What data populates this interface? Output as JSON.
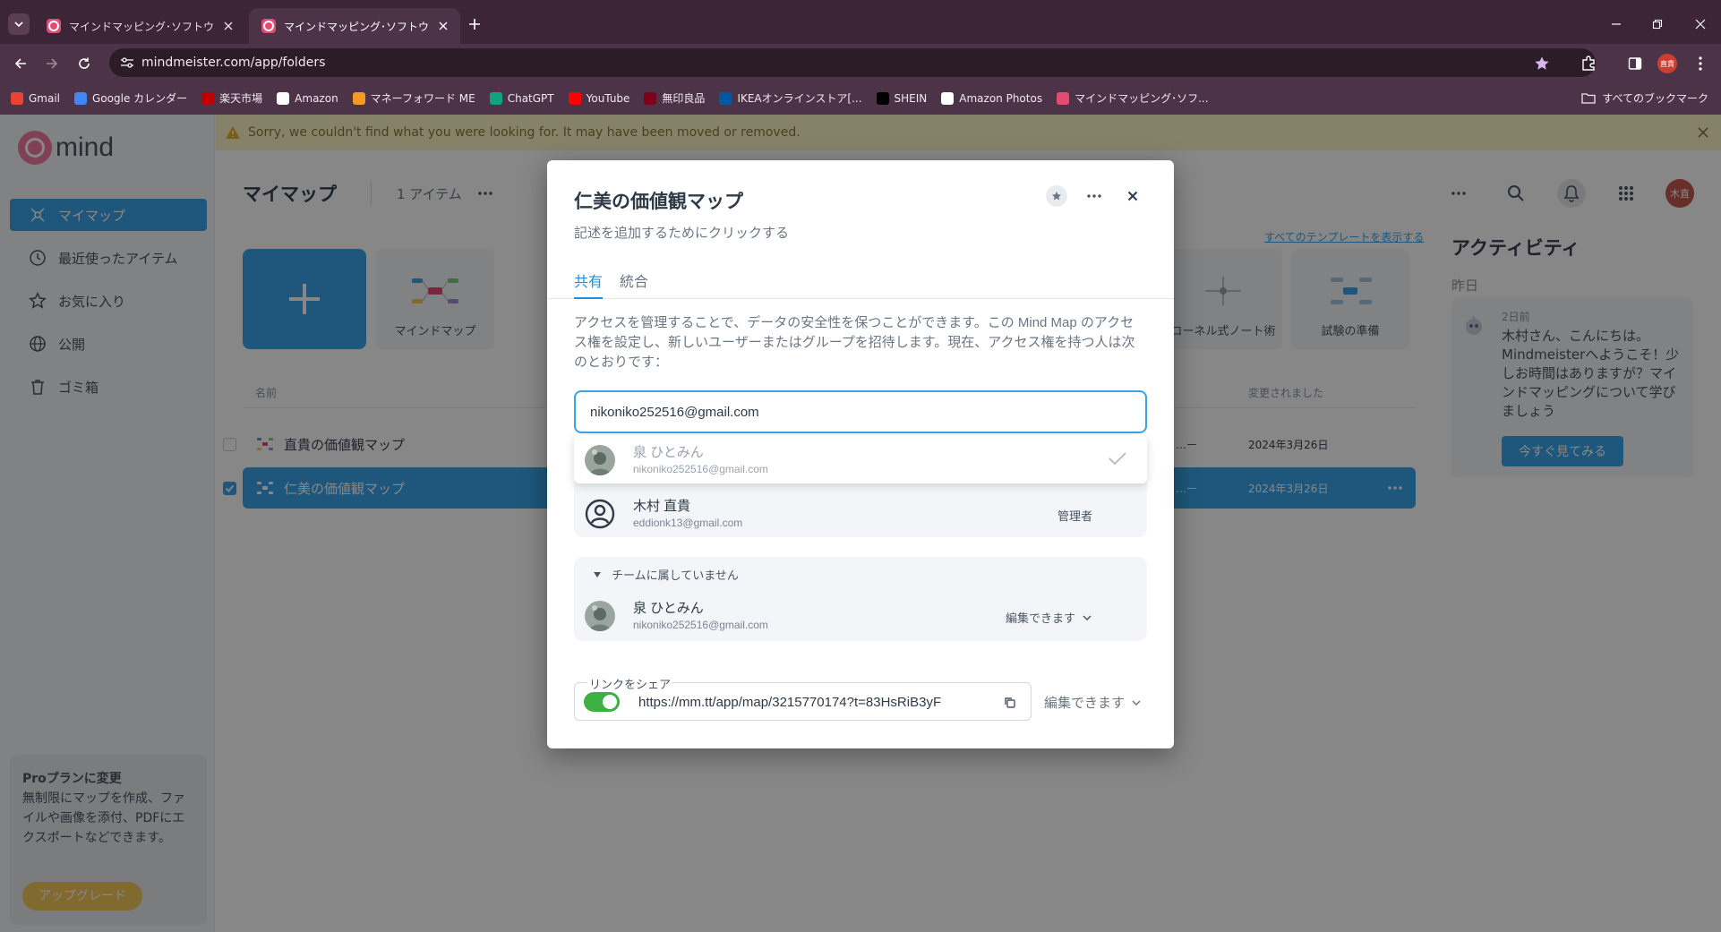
{
  "browser": {
    "tabs": [
      {
        "title": "マインドマッピング･ソフトウェア - オン",
        "active": false
      },
      {
        "title": "マインドマッピング･ソフトウェア - オン",
        "active": true
      }
    ],
    "url": "mindmeister.com/app/folders",
    "profile_initial": "直貴",
    "bookmarks": [
      {
        "label": "Gmail",
        "icon": "gmail-icon",
        "color": "#ea4335"
      },
      {
        "label": "Google カレンダー",
        "icon": "calendar-icon",
        "color": "#4285f4"
      },
      {
        "label": "楽天市場",
        "icon": "rakuten-icon",
        "color": "#bf0000"
      },
      {
        "label": "Amazon",
        "icon": "amazon-icon",
        "color": "#ffffff"
      },
      {
        "label": "マネーフォワード ME",
        "icon": "moneyforward-icon",
        "color": "#f59a23"
      },
      {
        "label": "ChatGPT",
        "icon": "chatgpt-icon",
        "color": "#10a37f"
      },
      {
        "label": "YouTube",
        "icon": "youtube-icon",
        "color": "#ff0000"
      },
      {
        "label": "無印良品",
        "icon": "muji-icon",
        "color": "#7f0019"
      },
      {
        "label": "IKEAオンラインストア[...",
        "icon": "ikea-icon",
        "color": "#0058a3"
      },
      {
        "label": "SHEIN",
        "icon": "shein-icon",
        "color": "#000000"
      },
      {
        "label": "Amazon Photos",
        "icon": "amazon-icon",
        "color": "#ffffff"
      },
      {
        "label": "マインドマッピング･ソフ...",
        "icon": "mindmeister-icon",
        "color": "#e34c72"
      }
    ],
    "all_bookmarks": "すべてのブックマーク"
  },
  "app": {
    "logo_text": "mind",
    "nav": [
      {
        "label": "マイマップ",
        "icon": "mindmap-icon",
        "active": true
      },
      {
        "label": "最近使ったアイテム",
        "icon": "clock-icon",
        "active": false
      },
      {
        "label": "お気に入り",
        "icon": "star-icon",
        "active": false
      },
      {
        "label": "公開",
        "icon": "globe-icon",
        "active": false
      },
      {
        "label": "ゴミ箱",
        "icon": "trash-icon",
        "active": false
      }
    ],
    "promo": {
      "title": "Proプランに変更",
      "body": "無制限にマップを作成、ファイルや画像を添付、PDFにエクスポートなどできます。",
      "button": "アップグレード"
    },
    "banner": "Sorry, we couldn't find what you were looking for. It may have been moved or removed.",
    "main_title": "マイマップ",
    "item_count": "1 アイテム",
    "templates": [
      "マインドマップ",
      "コーネル式ノート術",
      "試験の準備"
    ],
    "templates_link": "すべてのテンプレートを表示する",
    "table": {
      "col_name": "名前",
      "col_modified": "変更されました",
      "rows": [
        {
          "name": "直貴の価値観マップ",
          "owner": "…ー",
          "date": "2024年3月26日",
          "selected": false
        },
        {
          "name": "仁美の価値観マップ",
          "owner": "…ー",
          "date": "2024年3月26日",
          "selected": true
        }
      ]
    },
    "activity": {
      "title": "アクティビティ",
      "day": "昨日",
      "ago": "2日前",
      "message": "木村さん、こんにちは。Mindmeisterへようこそ！少しお時間はありますが？マインドマッピングについて学びましょう",
      "cta": "今すぐ見てみる"
    },
    "user_initial": "木直"
  },
  "modal": {
    "title": "仁美の価値観マップ",
    "description_placeholder": "記述を追加するためにクリックする",
    "tabs": [
      {
        "label": "共有",
        "active": true
      },
      {
        "label": "統合",
        "active": false
      }
    ],
    "info": "アクセスを管理することで、データの安全性を保つことができます。この Mind Map のアクセス権を設定し、新しいユーザーまたはグループを招待します。現在、アクセス権を持つ人は次のとおりです：",
    "invite_input": "nikoniko252516@gmail.com",
    "suggestion": {
      "name": "泉 ひとみん",
      "email": "nikoniko252516@gmail.com"
    },
    "members": [
      {
        "name": "木村 直貴",
        "email": "eddionk13@gmail.com",
        "role": "管理者"
      }
    ],
    "outside_team": {
      "header": "チームに属していません",
      "members": [
        {
          "name": "泉 ひとみん",
          "email": "nikoniko252516@gmail.com",
          "permission": "編集できます"
        }
      ]
    },
    "share_link": {
      "legend": "リンクをシェア",
      "enabled": true,
      "url": "https://mm.tt/app/map/3215770174?t=83HsRiB3yF",
      "permission": "編集できます"
    }
  }
}
